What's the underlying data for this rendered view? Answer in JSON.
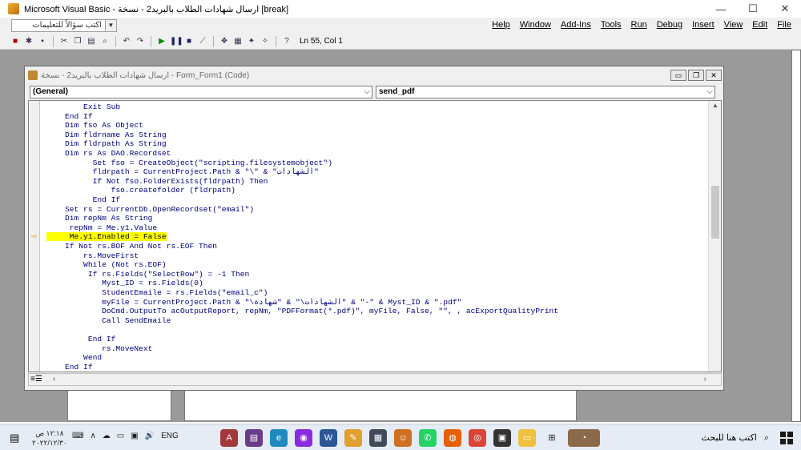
{
  "window": {
    "title": "Microsoft Visual Basic - ارسال شهادات الطلاب بالبريد2 - نسخة [break]",
    "minimize": "—",
    "maximize": "☐",
    "close": "✕"
  },
  "ask_box": {
    "placeholder": "اكتب سؤالاً للتعليمات"
  },
  "menu": [
    "Help",
    "Window",
    "Add-Ins",
    "Tools",
    "Run",
    "Debug",
    "Insert",
    "View",
    "Edit",
    "File"
  ],
  "toolbar": {
    "position": "Ln 55, Col 1"
  },
  "code_window": {
    "title": "ارسال شهادات الطلاب بالبريد2 - نسخة - Form_Form1 (Code)",
    "object_combo": "(General)",
    "proc_combo": "send_pdf",
    "lines": [
      "        Exit Sub",
      "    End If",
      "    Dim fso As Object",
      "    Dim fldrname As String",
      "    Dim fldrpath As String",
      "    Dim rs As DAO.Recordset",
      "          Set fso = CreateObject(\"scripting.filesystemobject\")",
      "          fldrpath = CurrentProject.Path & \"\\\" & \"الشهادات\"",
      "          If Not fso.FolderExists(fldrpath) Then",
      "              fso.createfolder (fldrpath)",
      "          End If",
      "    Set rs = CurrentDb.OpenRecordset(\"email\")",
      "    Dim repNm As String",
      "     repNm = Me.y1.Value",
      "     Me.y1.Enabled = False",
      "    If Not rs.BOF And Not rs.EOF Then",
      "        rs.MoveFirst",
      "        While (Not rs.EOF)",
      "         If rs.Fields(\"SelectRow\") = -1 Then",
      "            Myst_ID = rs.Fields(0)",
      "            StudentEmaile = rs.Fields(\"email_c\")",
      "            myFile = CurrentProject.Path & \"\\الشهادات\\\" & \"شهادة\" & \"-\" & Myst_ID & \".pdf\"",
      "            DoCmd.OutputTo acOutputReport, repNm, \"PDFFormat(*.pdf)\", myFile, False, \"\", , acExportQualityPrint",
      "            Call SendEmaile",
      "",
      "         End If",
      "            rs.MoveNext",
      "        Wend",
      "    End If"
    ],
    "highlight_line": 14
  },
  "taskbar": {
    "search": "اكتب هنا للبحث",
    "lang": "ENG",
    "time": "١٢:١٨ ص",
    "date": "٢٠٢٢/١٢/٣٠"
  }
}
